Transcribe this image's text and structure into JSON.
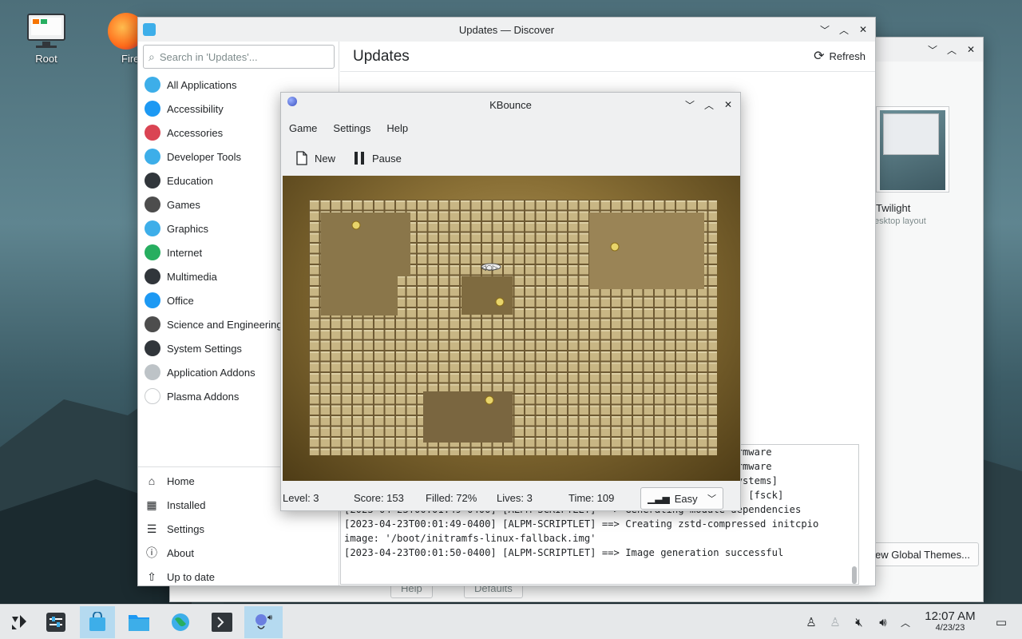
{
  "desktop": {
    "icons": [
      {
        "label": "Root"
      },
      {
        "label": "Fire"
      }
    ]
  },
  "settings_window": {
    "theme_name": "Twilight",
    "theme_sub": "esktop layout",
    "get_themes_label": "ew Global Themes...",
    "help_label": "Help",
    "defaults_label": "Defaults"
  },
  "discover": {
    "title": "Updates — Discover",
    "search_placeholder": "Search in 'Updates'...",
    "categories": [
      {
        "label": "All Applications",
        "color": "#3daee9",
        "icon": "grid-icon"
      },
      {
        "label": "Accessibility",
        "color": "#1d99f3",
        "icon": "accessibility-icon"
      },
      {
        "label": "Accessories",
        "color": "#da4453",
        "icon": "toolbox-icon"
      },
      {
        "label": "Developer Tools",
        "color": "#3daee9",
        "icon": "wrench-icon"
      },
      {
        "label": "Education",
        "color": "#31363b",
        "icon": "blackboard-icon"
      },
      {
        "label": "Games",
        "color": "#4d4d4d",
        "icon": "gamepad-icon"
      },
      {
        "label": "Graphics",
        "color": "#3daee9",
        "icon": "palette-icon"
      },
      {
        "label": "Internet",
        "color": "#27ae60",
        "icon": "globe-icon"
      },
      {
        "label": "Multimedia",
        "color": "#31363b",
        "icon": "monitor-icon"
      },
      {
        "label": "Office",
        "color": "#1d99f3",
        "icon": "document-icon"
      },
      {
        "label": "Science and Engineering",
        "color": "#4d4d4d",
        "icon": "flask-icon"
      },
      {
        "label": "System Settings",
        "color": "#31363b",
        "icon": "settings-panel-icon"
      },
      {
        "label": "Application Addons",
        "color": "#bdc3c7",
        "icon": "dots-icon"
      },
      {
        "label": "Plasma Addons",
        "color": "#ffffff",
        "icon": "sparkle-icon"
      }
    ],
    "nav": [
      {
        "label": "Home",
        "icon": "home-icon",
        "glyph": "⌂"
      },
      {
        "label": "Installed",
        "icon": "installed-icon",
        "glyph": "▦"
      },
      {
        "label": "Settings",
        "icon": "sliders-icon",
        "glyph": "☰"
      },
      {
        "label": "About",
        "icon": "info-icon",
        "glyph": "ⓘ"
      },
      {
        "label": "Up to date",
        "icon": "arrow-up-icon",
        "glyph": "⇧"
      }
    ],
    "page_title": "Updates",
    "refresh_label": "Refresh",
    "log_lines": [
      "                                                       y missing firmware",
      "",
      "                                                       y missing firmware",
      "",
      "                                                       hook: [filesystems]",
      "[2023-04-23T00:01:46-0400] [ALPM-SCRIPTLET]   -> Running build hook: [fsck]",
      "[2023-04-23T00:01:49-0400] [ALPM-SCRIPTLET] ==> Generating module dependencies",
      "[2023-04-23T00:01:49-0400] [ALPM-SCRIPTLET] ==> Creating zstd-compressed initcpio",
      "image: '/boot/initramfs-linux-fallback.img'",
      "[2023-04-23T00:01:50-0400] [ALPM-SCRIPTLET] ==> Image generation successful"
    ]
  },
  "kbounce": {
    "title": "KBounce",
    "menu": [
      "Game",
      "Settings",
      "Help"
    ],
    "toolbar": {
      "new_label": "New",
      "pause_label": "Pause"
    },
    "status": {
      "level": "Level: 3",
      "score": "Score: 153",
      "filled": "Filled: 72%",
      "lives": "Lives: 3",
      "time": "Time: 109"
    },
    "difficulty": "Easy",
    "filled_fraction": 0.72
  },
  "taskbar": {
    "time": "12:07 AM",
    "date": "4/23/23"
  }
}
